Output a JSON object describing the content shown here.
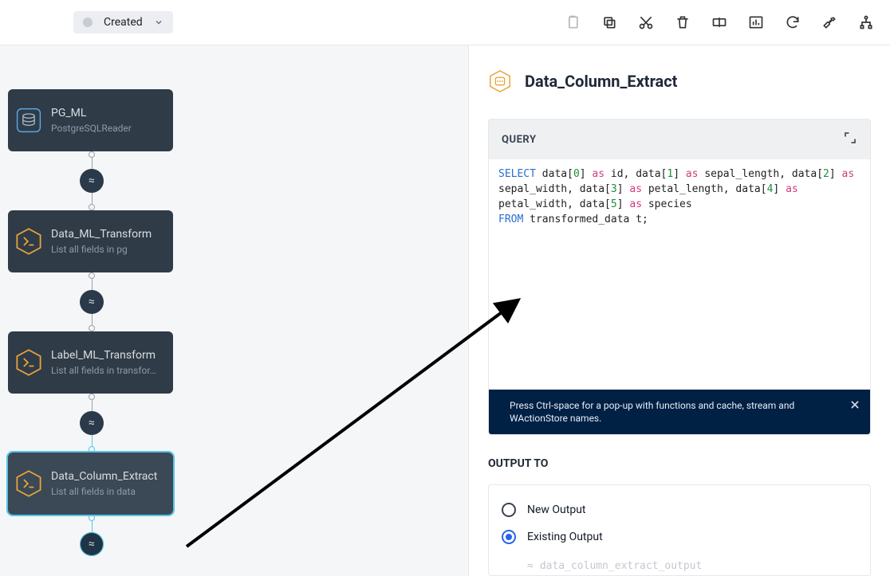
{
  "topbar": {
    "status": "Created"
  },
  "nodes": [
    {
      "title": "PG_ML",
      "subtitle": "PostgreSQLReader",
      "icon": "db"
    },
    {
      "title": "Data_ML_Transform",
      "subtitle": "List all fields in pg",
      "icon": "hex"
    },
    {
      "title": "Label_ML_Transform",
      "subtitle": "List all fields in transfor…",
      "icon": "hex"
    },
    {
      "title": "Data_Column_Extract",
      "subtitle": "List all fields in data",
      "icon": "hex",
      "selected": true
    }
  ],
  "panel": {
    "title": "Data_Column_Extract",
    "query_label": "QUERY",
    "code_tokens": [
      {
        "t": "SELECT",
        "c": "kw"
      },
      {
        "t": " data["
      },
      {
        "t": "0",
        "c": "num"
      },
      {
        "t": "] "
      },
      {
        "t": "as",
        "c": "kw-as"
      },
      {
        "t": " id, data["
      },
      {
        "t": "1",
        "c": "num"
      },
      {
        "t": "] "
      },
      {
        "t": "as",
        "c": "kw-as"
      },
      {
        "t": " sepal_length, data["
      },
      {
        "t": "2",
        "c": "num"
      },
      {
        "t": "] "
      },
      {
        "t": "as",
        "c": "kw-as"
      },
      {
        "t": " sepal_width, data["
      },
      {
        "t": "3",
        "c": "num"
      },
      {
        "t": "] "
      },
      {
        "t": "as",
        "c": "kw-as"
      },
      {
        "t": " petal_length, data["
      },
      {
        "t": "4",
        "c": "num"
      },
      {
        "t": "] "
      },
      {
        "t": "as",
        "c": "kw-as"
      },
      {
        "t": " petal_width, data["
      },
      {
        "t": "5",
        "c": "num"
      },
      {
        "t": "] "
      },
      {
        "t": "as",
        "c": "kw-as"
      },
      {
        "t": " species\n"
      },
      {
        "t": "FROM",
        "c": "kw"
      },
      {
        "t": " transformed_data t;"
      }
    ],
    "tip": "Press Ctrl-space for a pop-up with functions and cache, stream and WActionStore names.",
    "output_label": "OUTPUT TO",
    "output_options": {
      "new": "New Output",
      "existing": "Existing Output",
      "faded": "data_column_extract_output"
    }
  }
}
